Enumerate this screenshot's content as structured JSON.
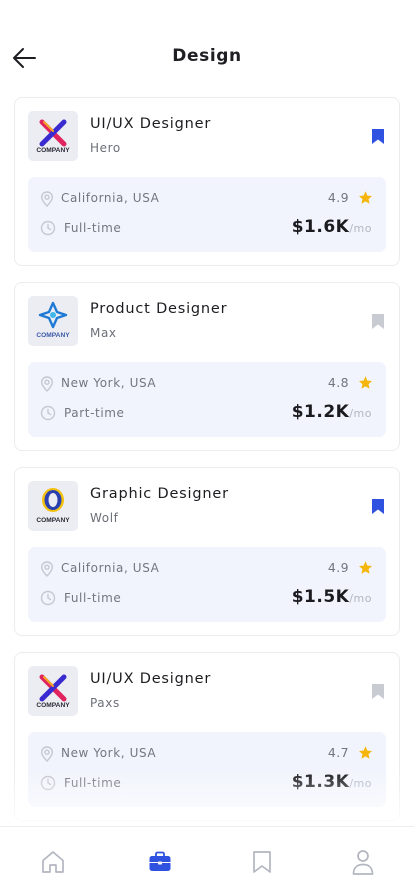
{
  "header": {
    "title": "Design"
  },
  "jobs": [
    {
      "title": "UI/UX Designer",
      "company": "Hero",
      "logo": "x-logo",
      "logo_text": "COMPANY",
      "location": "California, USA",
      "rating": "4.9",
      "type": "Full-time",
      "salary": "$1.6K",
      "period": "/mo",
      "bookmarked": true
    },
    {
      "title": "Product Designer",
      "company": "Max",
      "logo": "star-logo",
      "logo_text": "COMPANY",
      "location": "New York, USA",
      "rating": "4.8",
      "type": "Part-time",
      "salary": "$1.2K",
      "period": "/mo",
      "bookmarked": false
    },
    {
      "title": "Graphic Designer",
      "company": "Wolf",
      "logo": "o-logo",
      "logo_text": "COMPANY",
      "location": "California, USA",
      "rating": "4.9",
      "type": "Full-time",
      "salary": "$1.5K",
      "period": "/mo",
      "bookmarked": true
    },
    {
      "title": "UI/UX Designer",
      "company": "Paxs",
      "logo": "x-logo",
      "logo_text": "COMPANY",
      "location": "New York, USA",
      "rating": "4.7",
      "type": "Full-time",
      "salary": "$1.3K",
      "period": "/mo",
      "bookmarked": false
    }
  ],
  "nav": [
    {
      "name": "home",
      "icon": "home-icon",
      "active": false
    },
    {
      "name": "jobs",
      "icon": "briefcase-icon",
      "active": true
    },
    {
      "name": "saved",
      "icon": "bookmark-icon",
      "active": false
    },
    {
      "name": "profile",
      "icon": "user-icon",
      "active": false
    }
  ],
  "colors": {
    "accent": "#2f52e0",
    "star": "#f5b50a",
    "muted_icon": "#c6c8d0",
    "detail_bg": "#f1f4fc"
  }
}
